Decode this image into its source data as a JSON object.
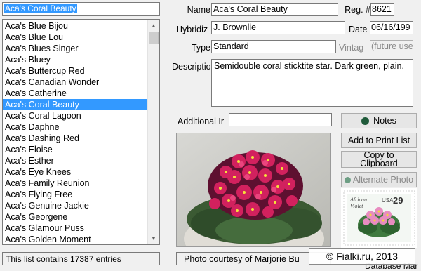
{
  "search": {
    "value": "Aca's Coral Beauty"
  },
  "variety_list": {
    "items": [
      "Aca's Blue Bijou",
      "Aca's Blue Lou",
      "Aca's Blues Singer",
      "Aca's Bluey",
      "Aca's Buttercup Red",
      "Aca's Canadian Wonder",
      "Aca's Catherine",
      "Aca's Coral Beauty",
      "Aca's Coral Lagoon",
      "Aca's Daphne",
      "Aca's Dashing Red",
      "Aca's Eloise",
      "Aca's Esther",
      "Aca's Eye Knees",
      "Aca's Family Reunion",
      "Aca's Flying Free",
      "Aca's Genuine Jackie",
      "Aca's Georgene",
      "Aca's Glamour Puss",
      "Aca's Golden Moment"
    ],
    "selected": "Aca's Coral Beauty"
  },
  "status": {
    "text": "This list contains 17387 entries"
  },
  "details": {
    "name_label": "Name",
    "name_value": "Aca's Coral Beauty",
    "reg_label": "Reg. #",
    "reg_value": "8621",
    "hybridizer_label": "Hybridiz",
    "hybridizer_value": "J. Brownlie",
    "date_label": "Date",
    "date_value": "06/16/199",
    "type_label": "Type",
    "type_value": "Standard",
    "vintage_label": "Vintag",
    "vintage_value": "(future use",
    "description_label": "Descriptio",
    "description_value": "Semidouble coral sticktite star. Dark green, plain.",
    "additional_label": "Additional Ir",
    "additional_value": ""
  },
  "buttons": {
    "notes": "Notes",
    "add_print": "Add to Print List",
    "copy_line1": "Copy to",
    "copy_line2": "Clipboard",
    "alt_photo": "Alternate Photo"
  },
  "stamp": {
    "word1": "African",
    "word2": "Violet",
    "country": "USA",
    "value": "29"
  },
  "photo": {
    "courtesy": "Photo courtesy of Marjorie Bu"
  },
  "watermark": {
    "text": "© Fialki.ru, 2013"
  },
  "hidden_label": {
    "text": "Database Mar"
  },
  "colors": {
    "selection": "#3399ff",
    "notes_dot": "#1f5a3a",
    "alt_photo_dot": "#6d9e84"
  }
}
